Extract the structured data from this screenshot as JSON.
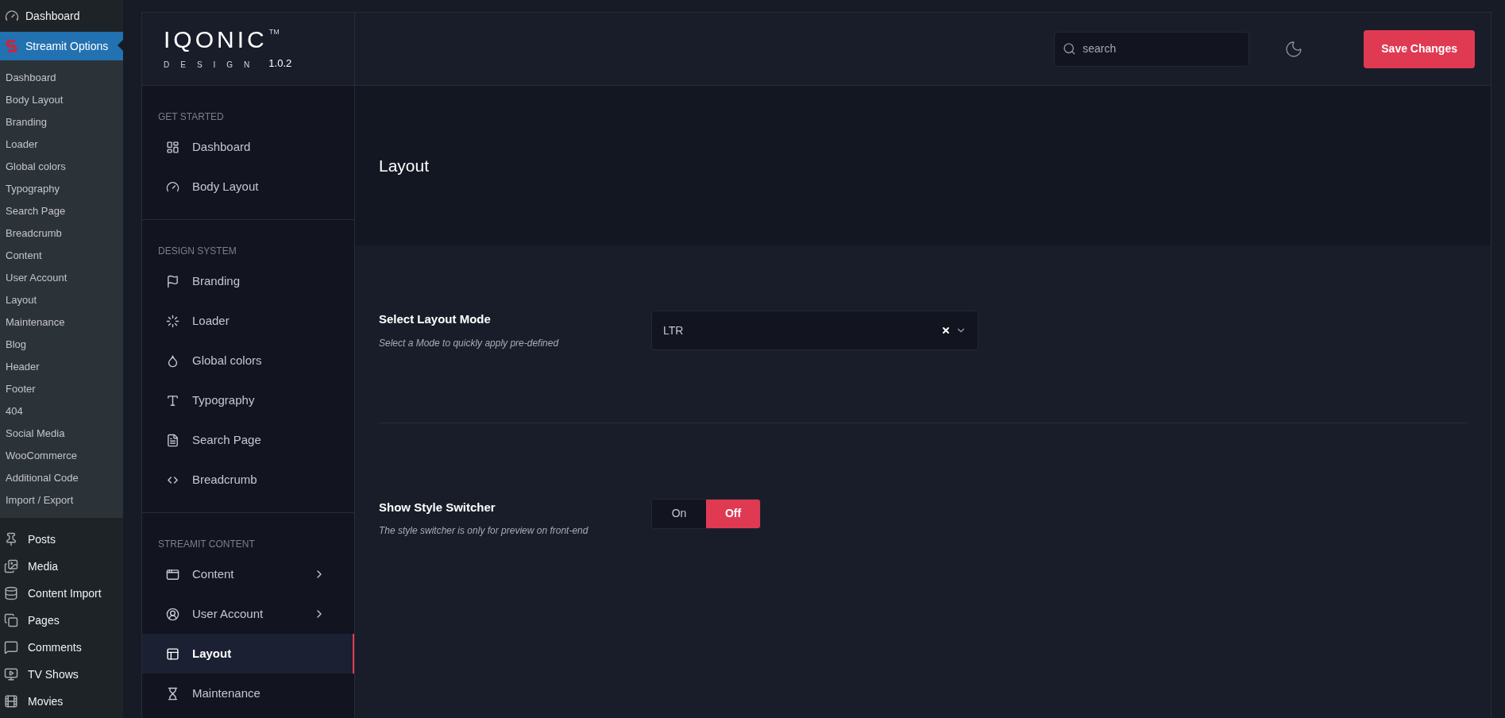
{
  "wp_menu": {
    "top": [
      {
        "label": "Dashboard",
        "selected": false
      },
      {
        "label": "Streamit Options",
        "selected": true
      }
    ],
    "submenu": [
      "Dashboard",
      "Body Layout",
      "Branding",
      "Loader",
      "Global colors",
      "Typography",
      "Search Page",
      "Breadcrumb",
      "Content",
      "User Account",
      "Layout",
      "Maintenance",
      "Blog",
      "Header",
      "Footer",
      "404",
      "Social Media",
      "WooCommerce",
      "Additional Code",
      "Import / Export"
    ],
    "bottom": [
      {
        "label": "Posts"
      },
      {
        "label": "Media"
      },
      {
        "label": "Content Import"
      },
      {
        "label": "Pages"
      },
      {
        "label": "Comments"
      },
      {
        "label": "TV Shows"
      },
      {
        "label": "Movies"
      }
    ]
  },
  "logo": {
    "wordmark": "IQONIC",
    "trademark": "TM",
    "subtitle": "DESIGN",
    "version": "1.0.2"
  },
  "header": {
    "search": {
      "placeholder": "search"
    },
    "save_button": "Save Changes"
  },
  "options_sidebar": [
    {
      "heading": "GET STARTED",
      "items": [
        {
          "label": "Dashboard",
          "selected": false,
          "expandable": false
        },
        {
          "label": "Body Layout",
          "selected": false,
          "expandable": false
        }
      ]
    },
    {
      "heading": "DESIGN SYSTEM",
      "items": [
        {
          "label": "Branding",
          "selected": false,
          "expandable": false
        },
        {
          "label": "Loader",
          "selected": false,
          "expandable": false
        },
        {
          "label": "Global colors",
          "selected": false,
          "expandable": false
        },
        {
          "label": "Typography",
          "selected": false,
          "expandable": false
        },
        {
          "label": "Search Page",
          "selected": false,
          "expandable": false
        },
        {
          "label": "Breadcrumb",
          "selected": false,
          "expandable": false
        }
      ]
    },
    {
      "heading": "STREAMIT CONTENT",
      "items": [
        {
          "label": "Content",
          "selected": false,
          "expandable": true
        },
        {
          "label": "User Account",
          "selected": false,
          "expandable": true
        },
        {
          "label": "Layout",
          "selected": true,
          "expandable": false
        },
        {
          "label": "Maintenance",
          "selected": false,
          "expandable": false
        }
      ]
    }
  ],
  "page_title": "Layout",
  "fields": [
    {
      "kind": "select",
      "label": "Select Layout Mode",
      "description": "Select a Mode to quickly apply pre-defined",
      "value": "LTR"
    },
    {
      "kind": "toggle",
      "label": "Show Style Switcher",
      "description": "The style switcher is only for preview on front-end",
      "options": [
        {
          "label": "On",
          "selected": false
        },
        {
          "label": "Off",
          "selected": true
        }
      ]
    }
  ]
}
